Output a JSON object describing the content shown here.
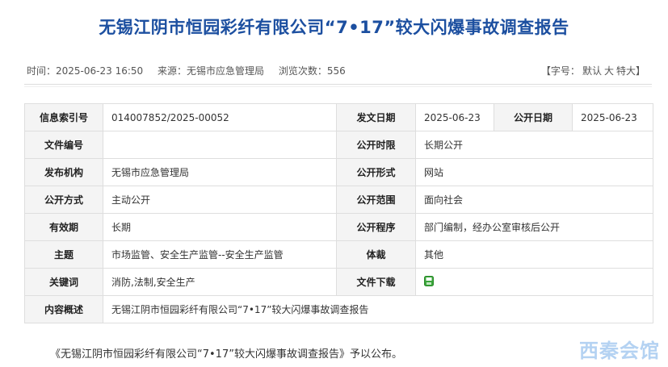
{
  "title": "无锡江阴市恒园彩纤有限公司“7•17”较大闪爆事故调查报告",
  "meta": {
    "time_label": "时间：",
    "time": "2025-06-23 16:50",
    "source_label": "来源：",
    "source": "无锡市应急管理局",
    "views_label": "浏览次数：",
    "views": "556"
  },
  "font_size": {
    "open": "【字号：",
    "default": "默认",
    "large": "大",
    "xlarge": "特大",
    "close": "】"
  },
  "info_table": {
    "index_no_label": "信息索引号",
    "index_no": "014007852/2025-00052",
    "issue_date_label": "发文日期",
    "issue_date": "2025-06-23",
    "public_date_label": "公开日期",
    "public_date": "2025-06-23",
    "doc_no_label": "文件编号",
    "doc_no": "",
    "public_period_label": "公开时限",
    "public_period": "长期公开",
    "publisher_label": "发布机构",
    "publisher": "无锡市应急管理局",
    "public_form_label": "公开形式",
    "public_form": "网站",
    "public_method_label": "公开方式",
    "public_method": "主动公开",
    "public_scope_label": "公开范围",
    "public_scope": "面向社会",
    "validity_label": "有效期",
    "validity": "长期",
    "public_procedure_label": "公开程序",
    "public_procedure": "部门编制，经办公室审核后公开",
    "subject_label": "主题",
    "subject": "市场监管、安全生产监管--安全生产监管",
    "genre_label": "体裁",
    "genre": "其他",
    "keywords_label": "关键词",
    "keywords": "消防,法制,安全生产",
    "download_label": "文件下载",
    "summary_label": "内容概述",
    "summary": "无锡江阴市恒园彩纤有限公司“7•17”较大闪爆事故调查报告"
  },
  "description": "《无锡江阴市恒园彩纤有限公司“7•17”较大闪爆事故调查报告》予以公布。",
  "watermark": "西秦会馆",
  "colors": {
    "title": "#1c4fa0",
    "download_icon": "#3aa53a"
  }
}
